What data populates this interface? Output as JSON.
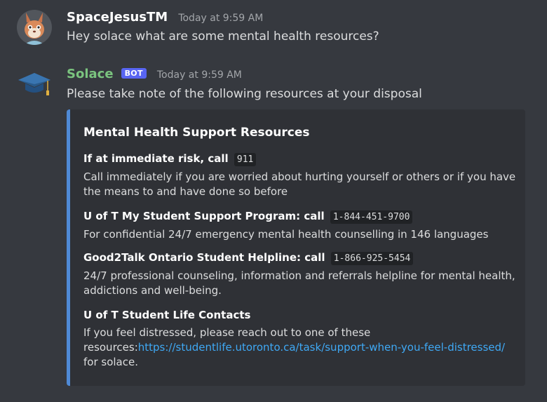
{
  "messages": [
    {
      "username": "SpaceJesusTM",
      "username_color": "#ffffff",
      "timestamp": "Today at 9:59 AM",
      "text": "Hey solace what are some mental health resources?"
    },
    {
      "username": "Solace",
      "username_color": "#7bc47f",
      "bot_tag": "BOT",
      "timestamp": "Today at 9:59 AM",
      "text": "Please take note of the following resources at your disposal",
      "embed": {
        "accent_color": "#4f8ad6",
        "title": "Mental Health Support Resources",
        "fields": [
          {
            "name": "If at immediate risk, call",
            "code": "911",
            "value_lines": [
              "Call immediately if you are worried about hurting yourself or others or if you have",
              "the means to and have done so before"
            ]
          },
          {
            "name": "U of T My Student Support Program: call",
            "code": "1-844-451-9700",
            "value_lines": [
              "For confidential 24/7 emergency mental health counselling in 146 languages"
            ]
          },
          {
            "name": "Good2Talk Ontario Student Helpline: call",
            "code": "1-866-925-5454",
            "value_lines": [
              "24/7 professional counseling, information and referrals helpline for mental health,",
              "addictions and well-being."
            ]
          },
          {
            "name": "U of T Student Life Contacts",
            "value_line1": "If you feel distressed, please reach out to one of these",
            "value_prefix": "resources:",
            "link": "https://studentlife.utoronto.ca/task/support-when-you-feel-distressed/",
            "value_line3": "for solace."
          }
        ]
      }
    }
  ]
}
